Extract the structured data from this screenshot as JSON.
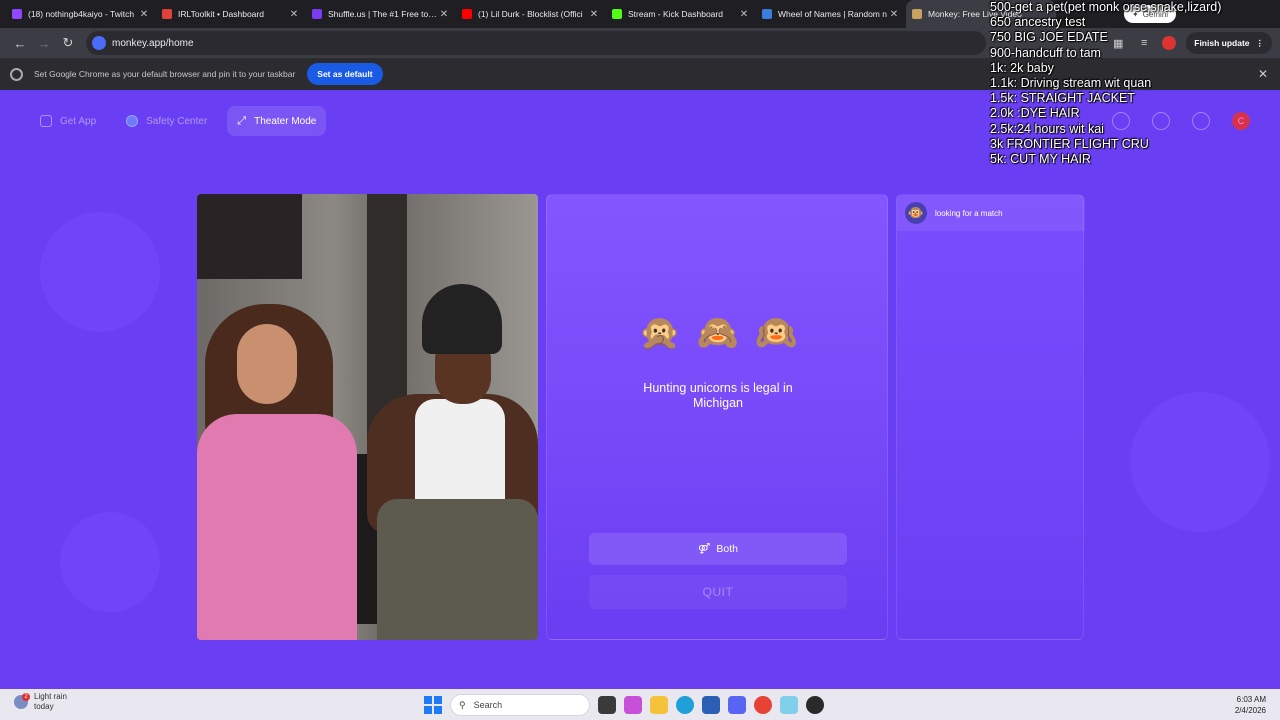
{
  "tabs": [
    {
      "title": "(18) nothingb4kaiyo - Twitch",
      "color": "#9146ff"
    },
    {
      "title": "IRLToolkit • Dashboard",
      "color": "#e0413a"
    },
    {
      "title": "Shuffle.us | The #1 Free to Pl",
      "color": "#7a3cf0"
    },
    {
      "title": "(1) Lil Durk - Blocklist (Offici",
      "color": "#ff0000"
    },
    {
      "title": "Stream - Kick Dashboard",
      "color": "#53fc18"
    },
    {
      "title": "Wheel of Names | Random n",
      "color": "#3b7ddd"
    },
    {
      "title": "Monkey: Free Live Video",
      "color": "#c8a060"
    }
  ],
  "toolbar": {
    "url": "monkey.app/home",
    "finish_update": "Finish update"
  },
  "infobar": {
    "message": "Set Google Chrome as your default browser and pin it to your taskbar",
    "button": "Set as default"
  },
  "page": {
    "nav": {
      "get_app": "Get App",
      "safety_center": "Safety Center",
      "theater_mode": "Theater Mode"
    },
    "profile_initial": "C",
    "emojis": [
      "🙊",
      "🙈",
      "🙉"
    ],
    "fact": "Hunting unicorns is legal in Michigan",
    "both_label": "Both",
    "quit_label": "QUIT",
    "chat_status": "looking for a match"
  },
  "overlay": {
    "gemini": "Gemini",
    "goals": [
      "500-get a pet(pet monk        orse,snake,lizard)",
      "650 ancestry test",
      "750 BIG JOE EDATE",
      "900-handcuff to tam",
      "1k: 2k baby",
      "1.1k: Driving stream wit quan",
      "1.5k: STRAIGHT JACKET",
      "2.0k :DYE HAIR",
      "2.5k:24 hours wit kai",
      "3k FRONTIER FLIGHT CRU",
      "5k: CUT MY HAIR"
    ]
  },
  "taskbar": {
    "weather_line1": "Light rain",
    "weather_line2": "today",
    "weather_badge": "2",
    "search": "Search",
    "time": "6:03 AM",
    "date": "2/4/2026"
  },
  "colors": {
    "page_bg": "#6a3ff3",
    "accent_blue": "#1a5be6"
  }
}
